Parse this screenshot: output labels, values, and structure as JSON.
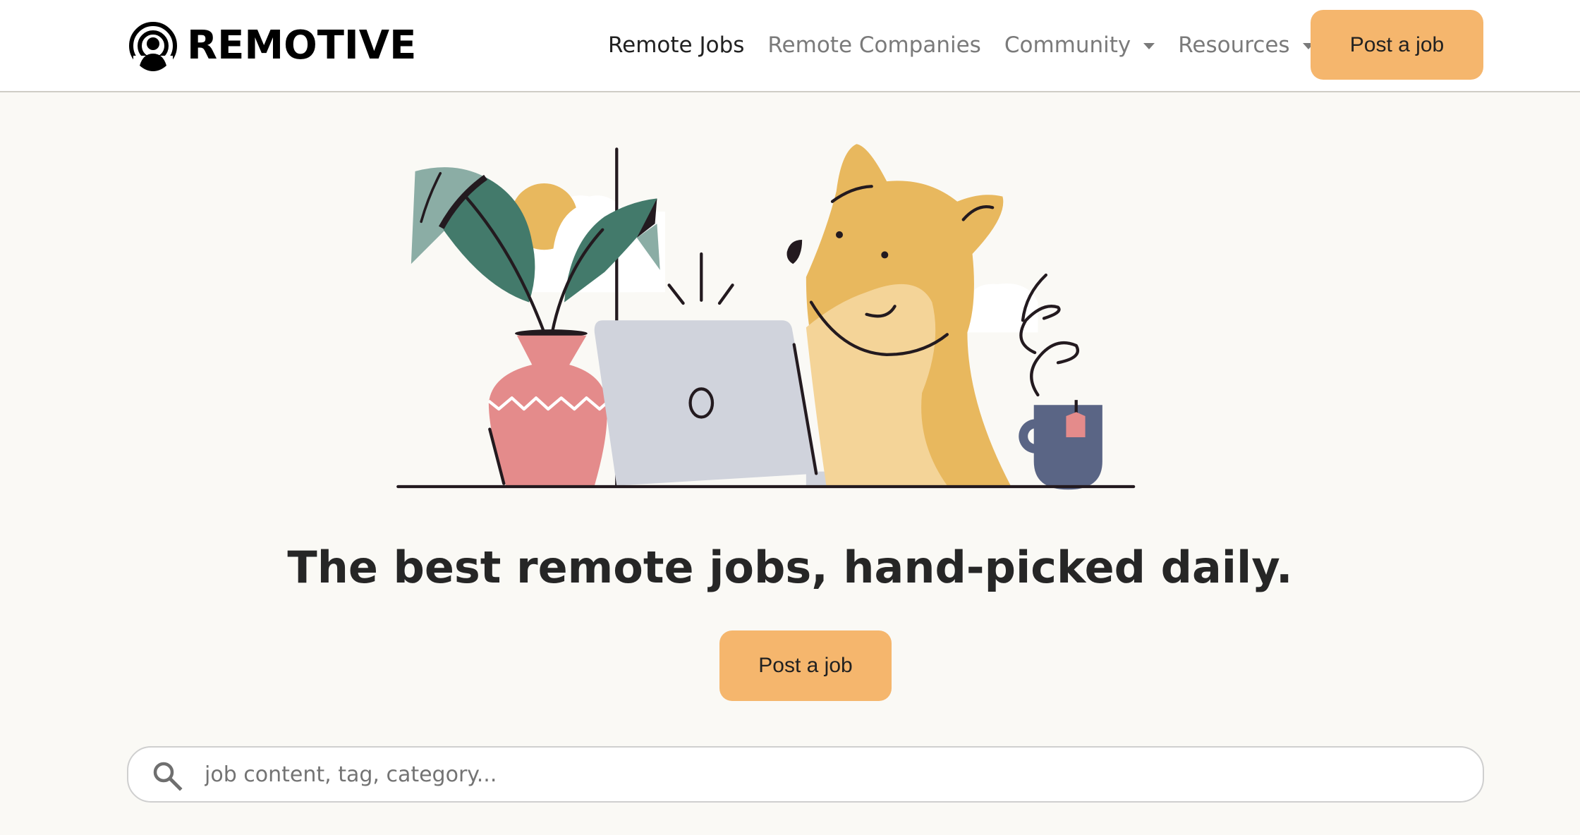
{
  "brand": {
    "name": "REMOTIVE",
    "logo_icon": "broadcast-person-icon"
  },
  "nav": {
    "items": [
      {
        "label": "Remote Jobs",
        "active": true,
        "dropdown": false
      },
      {
        "label": "Remote Companies",
        "active": false,
        "dropdown": false
      },
      {
        "label": "Community",
        "active": false,
        "dropdown": true
      },
      {
        "label": "Resources",
        "active": false,
        "dropdown": true
      }
    ],
    "post_job_label": "Post a job"
  },
  "hero": {
    "illustration": "dog-with-laptop-plant-and-mug-illustration",
    "headline": "The best remote jobs, hand-picked daily.",
    "post_job_label": "Post a job"
  },
  "search": {
    "icon": "search-icon",
    "placeholder": "job content, tag, category...",
    "value": ""
  },
  "colors": {
    "accent": "#f5b66d",
    "background": "#faf9f5",
    "header_bg": "#ffffff",
    "text": "#212121",
    "muted_text": "#7a7a7a"
  }
}
